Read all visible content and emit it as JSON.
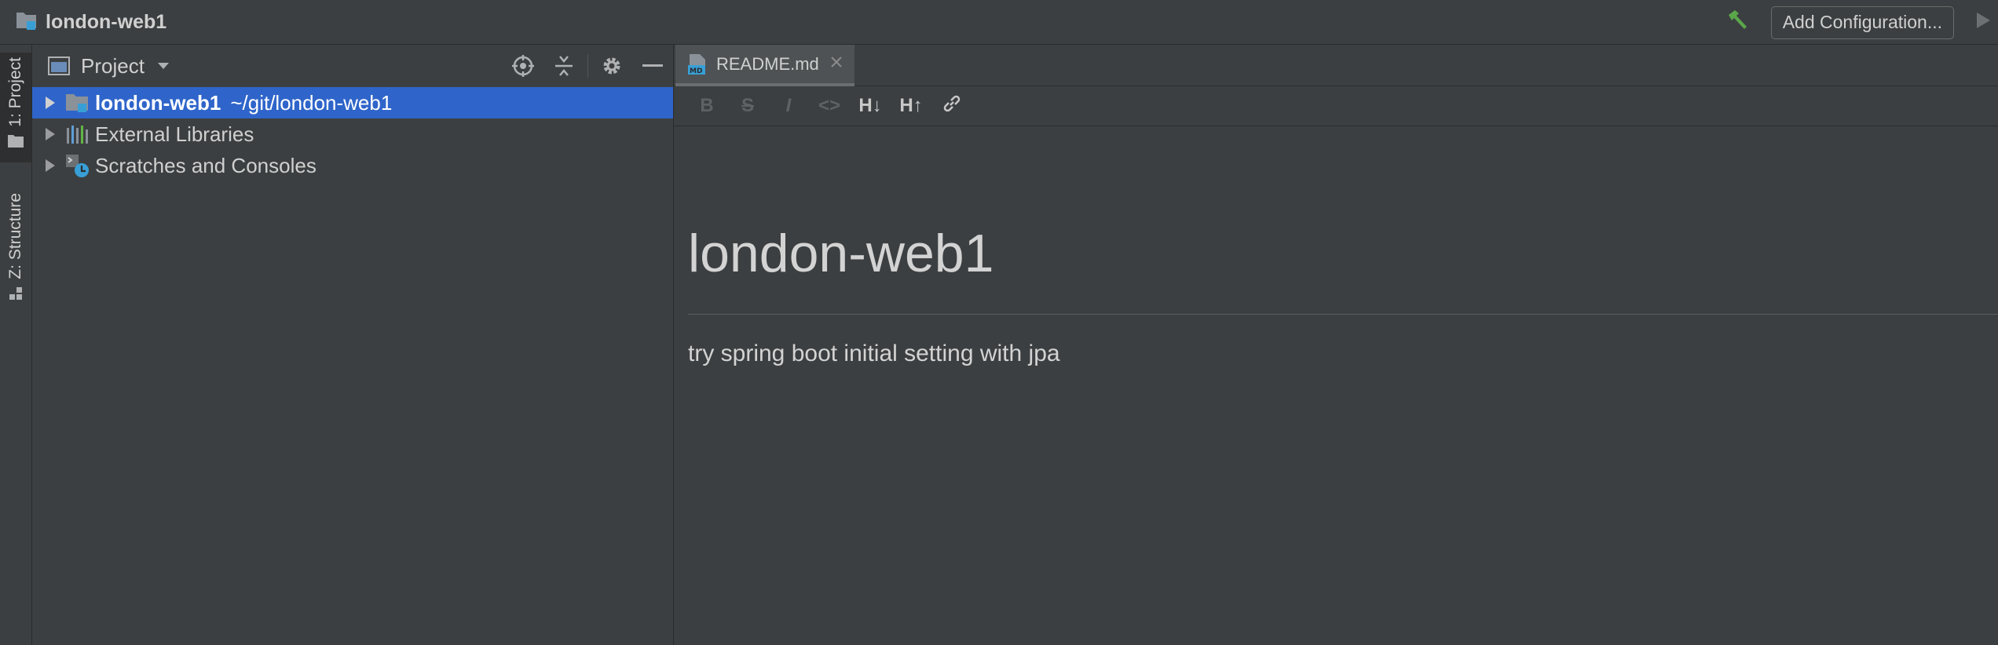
{
  "titlebar": {
    "project_name": "london-web1",
    "add_config_label": "Add Configuration..."
  },
  "left_strip": {
    "tabs": [
      {
        "label": "1: Project",
        "icon": "folder-icon",
        "active": true
      },
      {
        "label": "Z: Structure",
        "icon": "structure-icon",
        "active": false
      }
    ]
  },
  "project_panel": {
    "title": "Project",
    "tree": [
      {
        "label": "london-web1",
        "path": "~/git/london-web1",
        "icon": "module-folder-icon",
        "selected": true
      },
      {
        "label": "External Libraries",
        "path": "",
        "icon": "libraries-icon",
        "selected": false
      },
      {
        "label": "Scratches and Consoles",
        "path": "",
        "icon": "scratches-icon",
        "selected": false
      }
    ]
  },
  "editor": {
    "tab": {
      "label": "README.md",
      "icon": "markdown-file-icon"
    },
    "toolbar": {
      "bold": "B",
      "strike": "S",
      "italic": "I",
      "code": "<>",
      "header_down": "H↓",
      "header_up": "H↑"
    },
    "preview": {
      "heading": "london-web1",
      "paragraph": "try spring boot initial setting with jpa"
    }
  },
  "colors": {
    "background": "#3c3f41",
    "selection": "#2f65ca",
    "build_icon": "#5aa64a"
  }
}
